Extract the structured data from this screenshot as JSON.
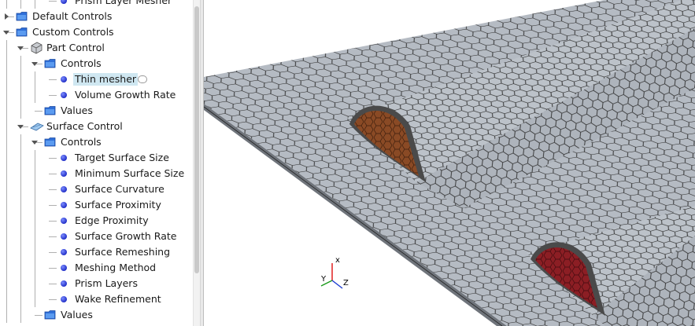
{
  "tree": {
    "items": [
      {
        "label": "Prism Layer Mesher",
        "level": 3,
        "icon": "dot-icon",
        "expander": "none"
      },
      {
        "label": "Default Controls",
        "level": 0,
        "icon": "folder-icon",
        "expander": "collapsed"
      },
      {
        "label": "Custom Controls",
        "level": 0,
        "icon": "folder-icon",
        "expander": "expanded"
      },
      {
        "label": "Part Control",
        "level": 1,
        "icon": "part-control-icon",
        "expander": "expanded"
      },
      {
        "label": "Controls",
        "level": 2,
        "icon": "folder-icon",
        "expander": "expanded"
      },
      {
        "label": "Thin mesher",
        "level": 3,
        "icon": "dot-icon",
        "expander": "none",
        "selected": true
      },
      {
        "label": "Volume Growth Rate",
        "level": 3,
        "icon": "dot-icon",
        "expander": "none"
      },
      {
        "label": "Values",
        "level": 2,
        "icon": "folder-icon",
        "expander": "none"
      },
      {
        "label": "Surface Control",
        "level": 1,
        "icon": "surface-control-icon",
        "expander": "expanded"
      },
      {
        "label": "Controls",
        "level": 2,
        "icon": "folder-icon",
        "expander": "expanded"
      },
      {
        "label": "Target Surface Size",
        "level": 3,
        "icon": "dot-icon",
        "expander": "none"
      },
      {
        "label": "Minimum Surface Size",
        "level": 3,
        "icon": "dot-icon",
        "expander": "none"
      },
      {
        "label": "Surface Curvature",
        "level": 3,
        "icon": "dot-icon",
        "expander": "none"
      },
      {
        "label": "Surface Proximity",
        "level": 3,
        "icon": "dot-icon",
        "expander": "none"
      },
      {
        "label": "Edge Proximity",
        "level": 3,
        "icon": "dot-icon",
        "expander": "none"
      },
      {
        "label": "Surface Growth Rate",
        "level": 3,
        "icon": "dot-icon",
        "expander": "none"
      },
      {
        "label": "Surface Remeshing",
        "level": 3,
        "icon": "dot-icon",
        "expander": "none"
      },
      {
        "label": "Meshing Method",
        "level": 3,
        "icon": "dot-icon",
        "expander": "none"
      },
      {
        "label": "Prism Layers",
        "level": 3,
        "icon": "dot-icon",
        "expander": "none"
      },
      {
        "label": "Wake Refinement",
        "level": 3,
        "icon": "dot-icon",
        "expander": "none"
      },
      {
        "label": "Values",
        "level": 2,
        "icon": "folder-icon",
        "expander": "none"
      }
    ]
  },
  "viewport": {
    "axes": {
      "x": "x",
      "y": "Y",
      "z": "Z"
    },
    "colors": {
      "mesh_face": "#b5bbc3",
      "mesh_edge": "#2e2e2e",
      "cut_face_upper": "#8a4a25",
      "cut_face_lower": "#8c1e24"
    }
  }
}
